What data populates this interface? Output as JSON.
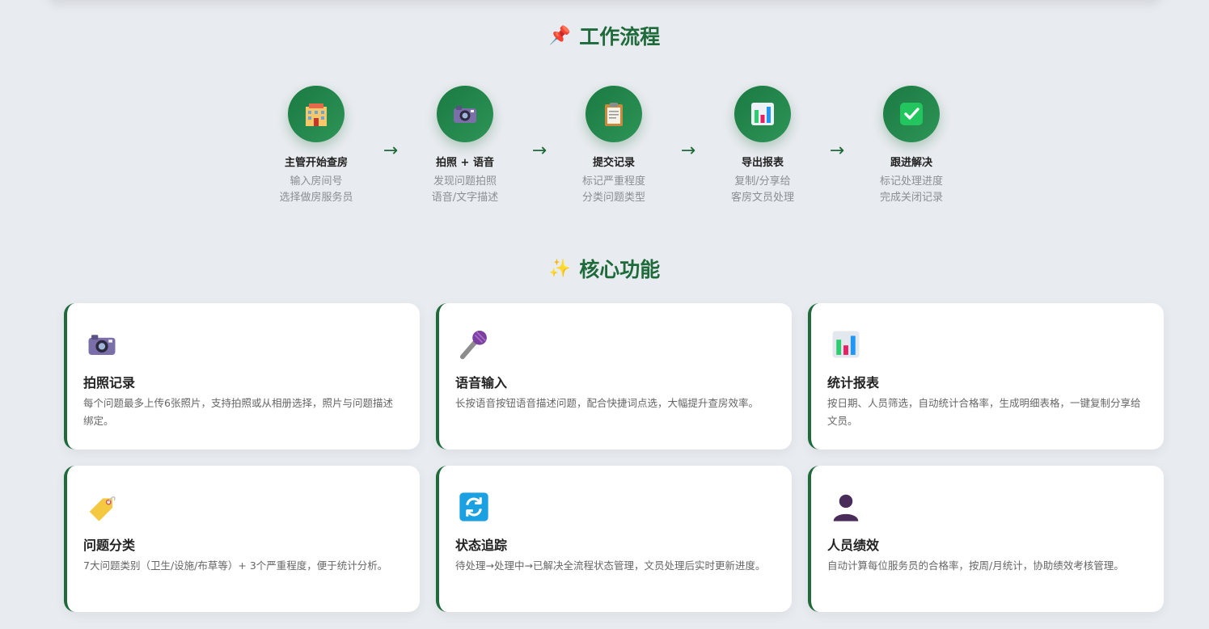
{
  "workflow": {
    "emoji": "📌",
    "title": "工作流程",
    "steps": [
      {
        "icon": "hotel-icon",
        "title": "主管开始查房",
        "line1": "输入房间号",
        "line2": "选择做房服务员"
      },
      {
        "icon": "camera-icon",
        "title": "拍照 + 语音",
        "line1": "发现问题拍照",
        "line2": "语音/文字描述"
      },
      {
        "icon": "clipboard-icon",
        "title": "提交记录",
        "line1": "标记严重程度",
        "line2": "分类问题类型"
      },
      {
        "icon": "bar-chart-icon",
        "title": "导出报表",
        "line1": "复制/分享给",
        "line2": "客房文员处理"
      },
      {
        "icon": "checkmark-icon",
        "title": "跟进解决",
        "line1": "标记处理进度",
        "line2": "完成关闭记录"
      }
    ],
    "arrow": "→"
  },
  "features": {
    "emoji": "✨",
    "title": "核心功能",
    "cards": [
      {
        "icon": "camera-icon",
        "title": "拍照记录",
        "desc": "每个问题最多上传6张照片，支持拍照或从相册选择，照片与问题描述绑定。"
      },
      {
        "icon": "microphone-icon",
        "title": "语音输入",
        "desc": "长按语音按钮语音描述问题，配合快捷词点选，大幅提升查房效率。"
      },
      {
        "icon": "bar-chart-icon",
        "title": "统计报表",
        "desc": "按日期、人员筛选，自动统计合格率，生成明细表格，一键复制分享给文员。"
      },
      {
        "icon": "tag-icon",
        "title": "问题分类",
        "desc": "7大问题类别（卫生/设施/布草等）+ 3个严重程度，便于统计分析。"
      },
      {
        "icon": "refresh-icon",
        "title": "状态追踪",
        "desc": "待处理→处理中→已解决全流程状态管理，文员处理后实时更新进度。"
      },
      {
        "icon": "person-icon",
        "title": "人员绩效",
        "desc": "自动计算每位服务员的合格率，按周/月统计，协助绩效考核管理。"
      }
    ]
  },
  "colors": {
    "accent": "#1e6a3b",
    "background": "#e8ebef"
  }
}
